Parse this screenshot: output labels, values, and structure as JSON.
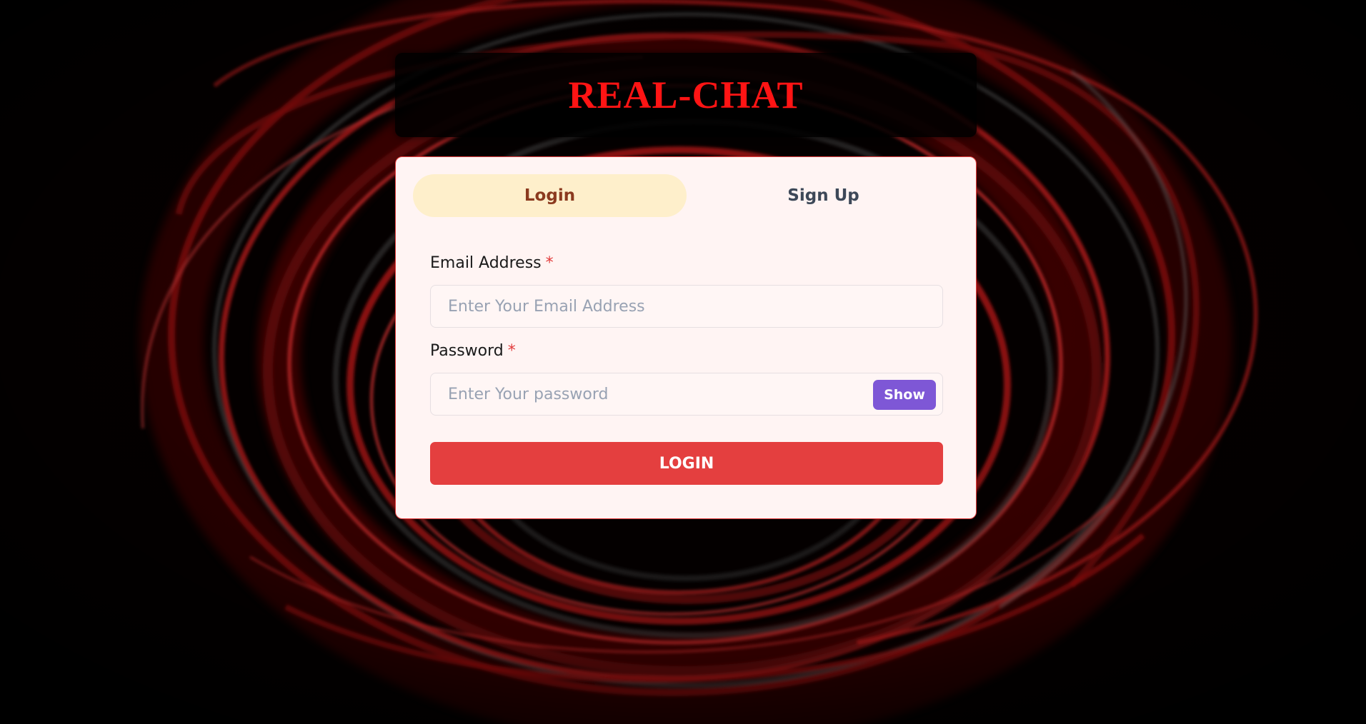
{
  "app": {
    "title": "REAL-CHAT"
  },
  "tabs": [
    {
      "label": "Login",
      "active": true
    },
    {
      "label": "Sign Up",
      "active": false
    }
  ],
  "login_form": {
    "email_label": "Email Address",
    "email_required_mark": "*",
    "email_placeholder": "Enter Your Email Address",
    "email_value": "",
    "password_label": "Password",
    "password_required_mark": "*",
    "password_placeholder": "Enter Your password",
    "password_value": "",
    "show_button_label": "Show",
    "submit_label": "LOGIN"
  },
  "colors": {
    "title": "#ff1414",
    "active_tab_bg": "#feefcb",
    "active_tab_text": "#8b3a1f",
    "show_button": "#7e57d6",
    "login_button": "#e43f3f",
    "card_bg": "#fff4f3",
    "required_mark": "#e23b3b"
  },
  "background": {
    "description_icon": "red-abstract-swirl-background"
  }
}
